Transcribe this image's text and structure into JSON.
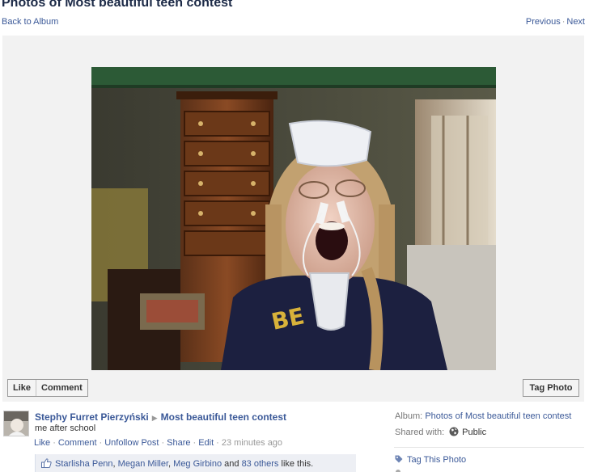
{
  "header": {
    "title": "Photos of Most beautiful teen contest",
    "back_link": "Back to Album",
    "previous": "Previous",
    "separator": "·",
    "next": "Next"
  },
  "photo_actions": {
    "like": "Like",
    "comment": "Comment",
    "tag_photo": "Tag Photo"
  },
  "story": {
    "actor": "Stephy Furret Pierzyński",
    "arrow": "▶",
    "target": "Most beautiful teen contest",
    "caption": "me after school",
    "actions": [
      "Like",
      "Comment",
      "Unfollow Post",
      "Share",
      "Edit"
    ],
    "dot": "·",
    "time": "23 minutes ago"
  },
  "likes": {
    "names": [
      "Starlisha Penn",
      "Megan Miller",
      "Meg Girbino"
    ],
    "comma": ",",
    "and": "and",
    "others": "83 others",
    "suffix": "like this."
  },
  "sidebar": {
    "album_label": "Album:",
    "album_name": "Photos of Most beautiful teen contest",
    "shared_label": "Shared with:",
    "audience": "Public",
    "tag_this_photo": "Tag This Photo"
  },
  "icons": {
    "thumb": "thumbs-up-icon",
    "globe": "globe-icon",
    "tag": "tag-icon",
    "arrow": "right-arrow-icon"
  },
  "colors": {
    "link": "#3b5998",
    "title": "#1c2a47",
    "stage": "#f2f2f2",
    "likes_bg": "#edeff4"
  }
}
